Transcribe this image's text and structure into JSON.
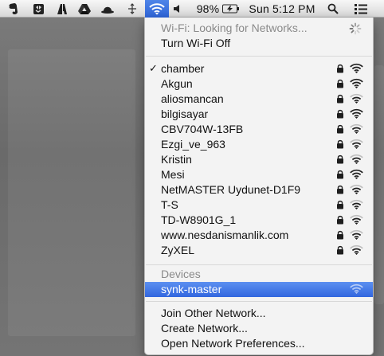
{
  "menubar": {
    "battery_percent": "98%",
    "clock": "Sun 5:12 PM",
    "icons": [
      "evernote-icon",
      "dropbox-icon",
      "adobe-icon",
      "google-drive-icon",
      "growl-icon",
      "cloud-icon",
      "bluetooth-icon",
      "wifi-icon",
      "volume-icon",
      "battery-icon",
      "spotlight-icon",
      "notification-list-icon"
    ]
  },
  "menu": {
    "status": "Wi-Fi: Looking for Networks...",
    "toggle": "Turn Wi-Fi Off",
    "networks": [
      {
        "name": "chamber",
        "checked": true,
        "locked": true,
        "signal": 3
      },
      {
        "name": "Akgun",
        "checked": false,
        "locked": true,
        "signal": 3
      },
      {
        "name": "aliosmancan",
        "checked": false,
        "locked": true,
        "signal": 2
      },
      {
        "name": "bilgisayar",
        "checked": false,
        "locked": true,
        "signal": 3
      },
      {
        "name": "CBV704W-13FB",
        "checked": false,
        "locked": true,
        "signal": 2
      },
      {
        "name": "Ezgi_ve_963",
        "checked": false,
        "locked": true,
        "signal": 2
      },
      {
        "name": "Kristin",
        "checked": false,
        "locked": true,
        "signal": 2
      },
      {
        "name": "Mesi",
        "checked": false,
        "locked": true,
        "signal": 3
      },
      {
        "name": "NetMASTER Uydunet-D1F9",
        "checked": false,
        "locked": true,
        "signal": 2
      },
      {
        "name": "T-S",
        "checked": false,
        "locked": true,
        "signal": 2
      },
      {
        "name": "TD-W8901G_1",
        "checked": false,
        "locked": true,
        "signal": 2
      },
      {
        "name": "www.nesdanismanlik.com",
        "checked": false,
        "locked": true,
        "signal": 2
      },
      {
        "name": "ZyXEL",
        "checked": false,
        "locked": true,
        "signal": 2
      }
    ],
    "devices_header": "Devices",
    "device": {
      "name": "synk-master",
      "signal": 3
    },
    "join_other": "Join Other Network...",
    "create_network": "Create Network...",
    "preferences": "Open Network Preferences..."
  },
  "colors": {
    "highlight": "#3f74e3",
    "menubar_bg": "#e8e8e8",
    "disabled_text": "#8a8a8a"
  }
}
